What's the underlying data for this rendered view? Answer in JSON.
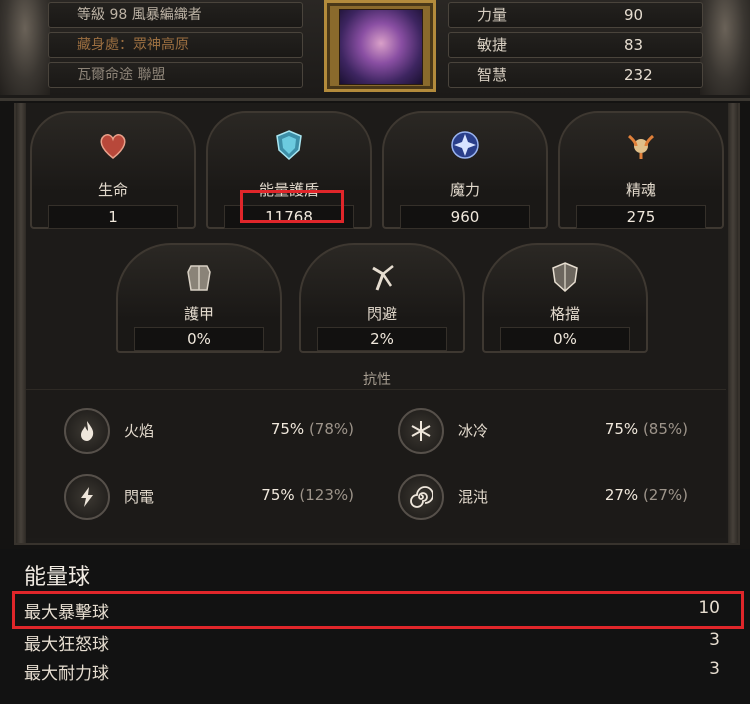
{
  "header": {
    "level_line": "等級 98 風暴編織者",
    "hideout_line": "藏身處：眾神高原",
    "league_line": "瓦爾命途 聯盟",
    "attributes": [
      {
        "label": "力量",
        "value": "90"
      },
      {
        "label": "敏捷",
        "value": "83"
      },
      {
        "label": "智慧",
        "value": "232"
      }
    ]
  },
  "defences": [
    {
      "label": "生命",
      "value": "1",
      "icon": "heart-icon",
      "color": "#c0483c"
    },
    {
      "label": "能量護盾",
      "value": "11768",
      "icon": "energy-shield-icon",
      "color": "#5ab8d0"
    },
    {
      "label": "魔力",
      "value": "960",
      "icon": "mana-icon",
      "color": "#6a8de0"
    },
    {
      "label": "精魂",
      "value": "275",
      "icon": "spirit-icon",
      "color": "#e0a060"
    }
  ],
  "mitigation": [
    {
      "label": "護甲",
      "value": "0%",
      "icon": "armour-icon"
    },
    {
      "label": "閃避",
      "value": "2%",
      "icon": "evasion-icon"
    },
    {
      "label": "格擋",
      "value": "0%",
      "icon": "block-icon"
    }
  ],
  "resistances": {
    "title": "抗性",
    "items": [
      {
        "name": "火焰",
        "value": "75%",
        "max": "(78%)",
        "icon": "fire-icon"
      },
      {
        "name": "冰冷",
        "value": "75%",
        "max": "(85%)",
        "icon": "cold-icon"
      },
      {
        "name": "閃電",
        "value": "75%",
        "max": "(123%)",
        "icon": "lightning-icon"
      },
      {
        "name": "混沌",
        "value": "27%",
        "max": "(27%)",
        "icon": "chaos-icon"
      }
    ]
  },
  "charges": {
    "title": "能量球",
    "rows": [
      {
        "name": "最大暴擊球",
        "value": "10"
      },
      {
        "name": "最大狂怒球",
        "value": "3"
      },
      {
        "name": "最大耐力球",
        "value": "3"
      }
    ]
  },
  "highlight_color": "#e0262a"
}
